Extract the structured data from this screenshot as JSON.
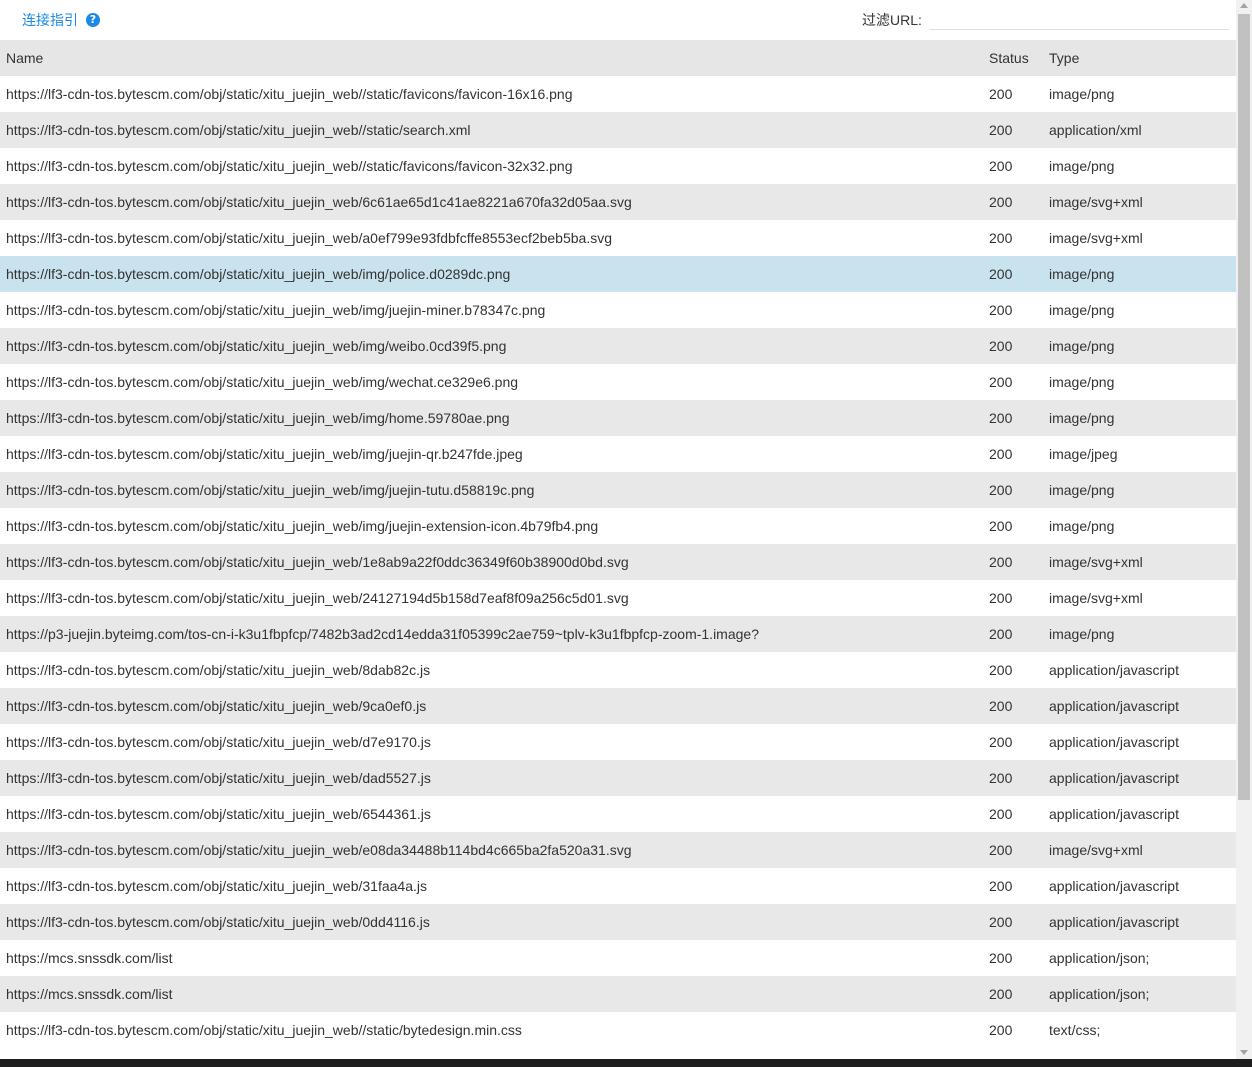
{
  "header": {
    "guide_link": "连接指引",
    "help_icon": "?",
    "filter_label": "过滤URL:",
    "filter_value": ""
  },
  "table": {
    "columns": {
      "name": "Name",
      "status": "Status",
      "type": "Type"
    },
    "selected_index": 5,
    "rows": [
      {
        "name": "https://lf3-cdn-tos.bytescm.com/obj/static/xitu_juejin_web//static/favicons/favicon-16x16.png",
        "status": "200",
        "type": "image/png"
      },
      {
        "name": "https://lf3-cdn-tos.bytescm.com/obj/static/xitu_juejin_web//static/search.xml",
        "status": "200",
        "type": "application/xml"
      },
      {
        "name": "https://lf3-cdn-tos.bytescm.com/obj/static/xitu_juejin_web//static/favicons/favicon-32x32.png",
        "status": "200",
        "type": "image/png"
      },
      {
        "name": "https://lf3-cdn-tos.bytescm.com/obj/static/xitu_juejin_web/6c61ae65d1c41ae8221a670fa32d05aa.svg",
        "status": "200",
        "type": "image/svg+xml"
      },
      {
        "name": "https://lf3-cdn-tos.bytescm.com/obj/static/xitu_juejin_web/a0ef799e93fdbfcffe8553ecf2beb5ba.svg",
        "status": "200",
        "type": "image/svg+xml"
      },
      {
        "name": "https://lf3-cdn-tos.bytescm.com/obj/static/xitu_juejin_web/img/police.d0289dc.png",
        "status": "200",
        "type": "image/png"
      },
      {
        "name": "https://lf3-cdn-tos.bytescm.com/obj/static/xitu_juejin_web/img/juejin-miner.b78347c.png",
        "status": "200",
        "type": "image/png"
      },
      {
        "name": "https://lf3-cdn-tos.bytescm.com/obj/static/xitu_juejin_web/img/weibo.0cd39f5.png",
        "status": "200",
        "type": "image/png"
      },
      {
        "name": "https://lf3-cdn-tos.bytescm.com/obj/static/xitu_juejin_web/img/wechat.ce329e6.png",
        "status": "200",
        "type": "image/png"
      },
      {
        "name": "https://lf3-cdn-tos.bytescm.com/obj/static/xitu_juejin_web/img/home.59780ae.png",
        "status": "200",
        "type": "image/png"
      },
      {
        "name": "https://lf3-cdn-tos.bytescm.com/obj/static/xitu_juejin_web/img/juejin-qr.b247fde.jpeg",
        "status": "200",
        "type": "image/jpeg"
      },
      {
        "name": "https://lf3-cdn-tos.bytescm.com/obj/static/xitu_juejin_web/img/juejin-tutu.d58819c.png",
        "status": "200",
        "type": "image/png"
      },
      {
        "name": "https://lf3-cdn-tos.bytescm.com/obj/static/xitu_juejin_web/img/juejin-extension-icon.4b79fb4.png",
        "status": "200",
        "type": "image/png"
      },
      {
        "name": "https://lf3-cdn-tos.bytescm.com/obj/static/xitu_juejin_web/1e8ab9a22f0ddc36349f60b38900d0bd.svg",
        "status": "200",
        "type": "image/svg+xml"
      },
      {
        "name": "https://lf3-cdn-tos.bytescm.com/obj/static/xitu_juejin_web/24127194d5b158d7eaf8f09a256c5d01.svg",
        "status": "200",
        "type": "image/svg+xml"
      },
      {
        "name": "https://p3-juejin.byteimg.com/tos-cn-i-k3u1fbpfcp/7482b3ad2cd14edda31f05399c2ae759~tplv-k3u1fbpfcp-zoom-1.image?",
        "status": "200",
        "type": "image/png"
      },
      {
        "name": "https://lf3-cdn-tos.bytescm.com/obj/static/xitu_juejin_web/8dab82c.js",
        "status": "200",
        "type": "application/javascript"
      },
      {
        "name": "https://lf3-cdn-tos.bytescm.com/obj/static/xitu_juejin_web/9ca0ef0.js",
        "status": "200",
        "type": "application/javascript"
      },
      {
        "name": "https://lf3-cdn-tos.bytescm.com/obj/static/xitu_juejin_web/d7e9170.js",
        "status": "200",
        "type": "application/javascript"
      },
      {
        "name": "https://lf3-cdn-tos.bytescm.com/obj/static/xitu_juejin_web/dad5527.js",
        "status": "200",
        "type": "application/javascript"
      },
      {
        "name": "https://lf3-cdn-tos.bytescm.com/obj/static/xitu_juejin_web/6544361.js",
        "status": "200",
        "type": "application/javascript"
      },
      {
        "name": "https://lf3-cdn-tos.bytescm.com/obj/static/xitu_juejin_web/e08da34488b114bd4c665ba2fa520a31.svg",
        "status": "200",
        "type": "image/svg+xml"
      },
      {
        "name": "https://lf3-cdn-tos.bytescm.com/obj/static/xitu_juejin_web/31faa4a.js",
        "status": "200",
        "type": "application/javascript"
      },
      {
        "name": "https://lf3-cdn-tos.bytescm.com/obj/static/xitu_juejin_web/0dd4116.js",
        "status": "200",
        "type": "application/javascript"
      },
      {
        "name": "https://mcs.snssdk.com/list",
        "status": "200",
        "type": "application/json;"
      },
      {
        "name": "https://mcs.snssdk.com/list",
        "status": "200",
        "type": "application/json;"
      },
      {
        "name": "https://lf3-cdn-tos.bytescm.com/obj/static/xitu_juejin_web//static/bytedesign.min.css",
        "status": "200",
        "type": "text/css;"
      }
    ]
  }
}
